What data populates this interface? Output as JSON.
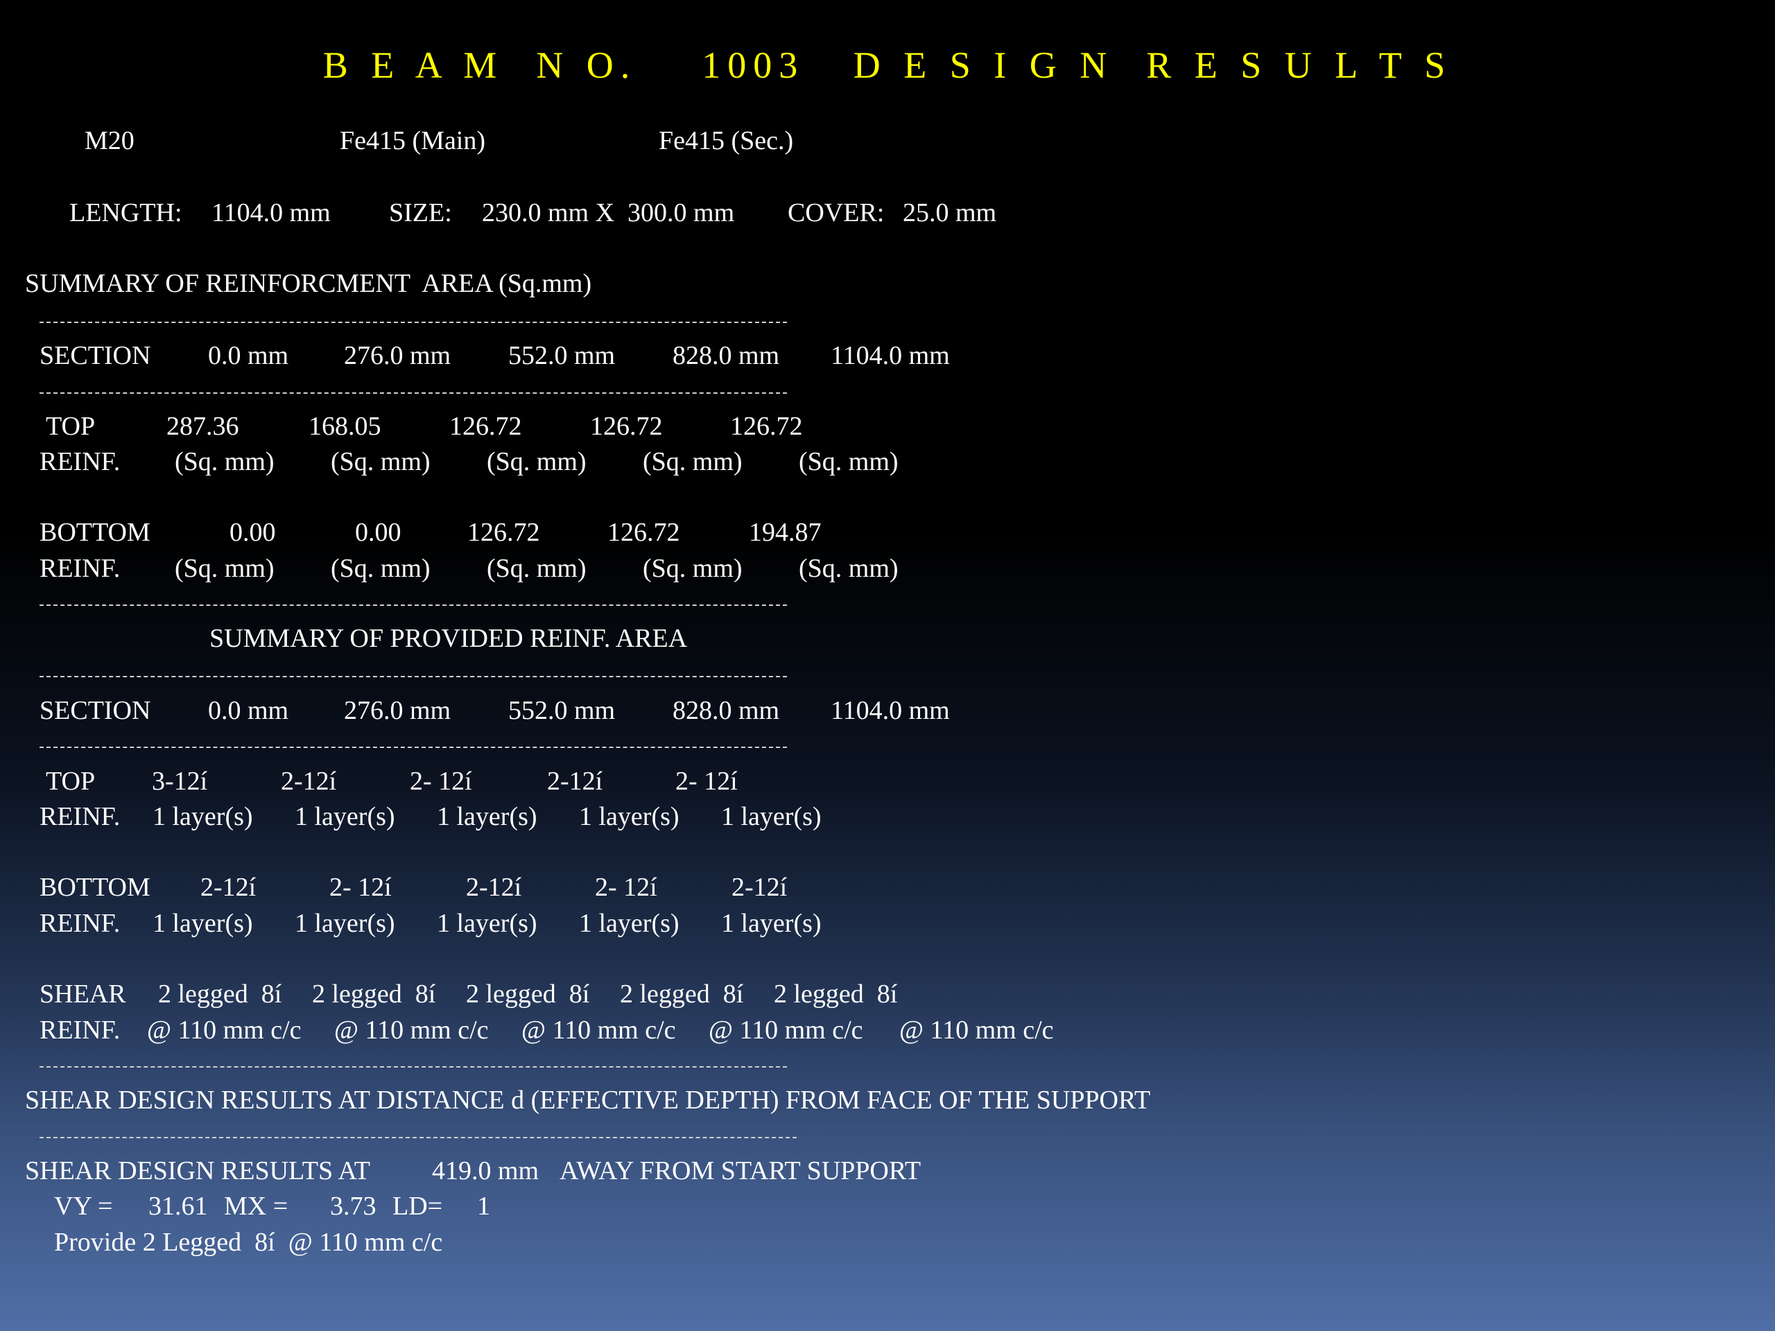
{
  "title": "B E A M  N O.    1003   D E S I G N  R E S U L T S",
  "materials": {
    "concrete": "M20",
    "main_steel": "Fe415 (Main)",
    "sec_steel": "Fe415 (Sec.)"
  },
  "dimensions": {
    "length_label": "LENGTH:",
    "length": "1104.0 mm",
    "size_label": "SIZE:",
    "size": "230.0 mm X  300.0 mm",
    "cover_label": "COVER:",
    "cover": "25.0 mm"
  },
  "required": {
    "heading": "SUMMARY OF REINFORCMENT  AREA (Sq.mm)",
    "section_label": "SECTION",
    "sections": [
      "0.0 mm",
      "276.0 mm",
      "552.0 mm",
      "828.0 mm",
      "1104.0 mm"
    ],
    "top_label": "TOP",
    "top_values": [
      "287.36",
      "168.05",
      "126.72",
      "126.72",
      "126.72"
    ],
    "reinf_label": "REINF.",
    "unit": "(Sq. mm)",
    "bottom_label": "BOTTOM",
    "bottom_values": [
      "0.00",
      "0.00",
      "126.72",
      "126.72",
      "194.87"
    ]
  },
  "provided": {
    "heading": "SUMMARY OF PROVIDED REINF. AREA",
    "section_label": "SECTION",
    "sections": [
      "0.0 mm",
      "276.0 mm",
      "552.0 mm",
      "828.0 mm",
      "1104.0 mm"
    ],
    "top_label": "TOP",
    "top_bars": [
      "3-12í",
      "2-12í",
      "2- 12í",
      "2-12í",
      "2- 12í"
    ],
    "reinf_label": "REINF.",
    "layers": [
      "1 layer(s)",
      "1 layer(s)",
      "1 layer(s)",
      "1 layer(s)",
      "1 layer(s)"
    ],
    "bottom_label": "BOTTOM",
    "bottom_bars": [
      "2-12í",
      "2- 12í",
      "2-12í",
      "2- 12í",
      "2-12í"
    ],
    "shear_label": "SHEAR",
    "shear_legs": [
      "2 legged  8í",
      "2 legged  8í",
      "2 legged  8í",
      "2 legged  8í",
      "2 legged  8í"
    ],
    "shear_spacing": [
      "@ 110 mm c/c",
      "@ 110 mm c/c",
      "@ 110 mm c/c",
      "@ 110 mm c/c",
      "@ 110 mm c/c"
    ]
  },
  "shear_design": {
    "heading": "SHEAR DESIGN RESULTS AT DISTANCE d (EFFECTIVE DEPTH) FROM FACE OF THE SUPPORT",
    "at_prefix": "SHEAR DESIGN RESULTS AT",
    "distance": "419.0 mm",
    "at_suffix": "AWAY FROM START SUPPORT",
    "vy_label": "VY =",
    "vy": "31.61",
    "mx_label": "MX =",
    "mx": "3.73",
    "ld_label": "LD=",
    "ld": "1",
    "provide": "Provide 2 Legged  8í  @ 110 mm c/c"
  }
}
